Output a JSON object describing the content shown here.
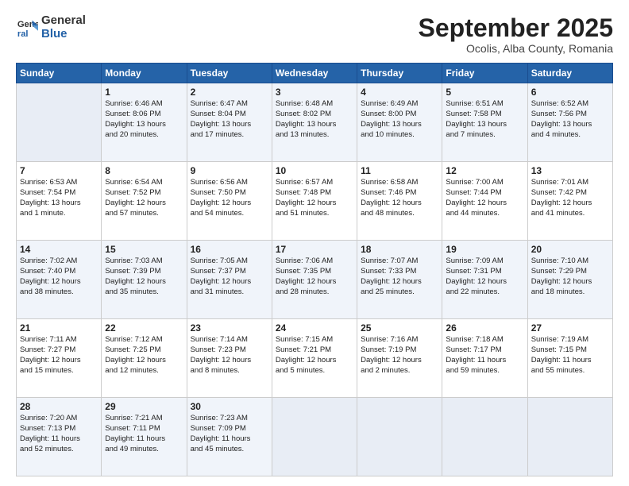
{
  "logo": {
    "line1": "General",
    "line2": "Blue"
  },
  "title": "September 2025",
  "subtitle": "Ocolis, Alba County, Romania",
  "days": [
    "Sunday",
    "Monday",
    "Tuesday",
    "Wednesday",
    "Thursday",
    "Friday",
    "Saturday"
  ],
  "weeks": [
    [
      {
        "num": "",
        "text": ""
      },
      {
        "num": "1",
        "text": "Sunrise: 6:46 AM\nSunset: 8:06 PM\nDaylight: 13 hours\nand 20 minutes."
      },
      {
        "num": "2",
        "text": "Sunrise: 6:47 AM\nSunset: 8:04 PM\nDaylight: 13 hours\nand 17 minutes."
      },
      {
        "num": "3",
        "text": "Sunrise: 6:48 AM\nSunset: 8:02 PM\nDaylight: 13 hours\nand 13 minutes."
      },
      {
        "num": "4",
        "text": "Sunrise: 6:49 AM\nSunset: 8:00 PM\nDaylight: 13 hours\nand 10 minutes."
      },
      {
        "num": "5",
        "text": "Sunrise: 6:51 AM\nSunset: 7:58 PM\nDaylight: 13 hours\nand 7 minutes."
      },
      {
        "num": "6",
        "text": "Sunrise: 6:52 AM\nSunset: 7:56 PM\nDaylight: 13 hours\nand 4 minutes."
      }
    ],
    [
      {
        "num": "7",
        "text": "Sunrise: 6:53 AM\nSunset: 7:54 PM\nDaylight: 13 hours\nand 1 minute."
      },
      {
        "num": "8",
        "text": "Sunrise: 6:54 AM\nSunset: 7:52 PM\nDaylight: 12 hours\nand 57 minutes."
      },
      {
        "num": "9",
        "text": "Sunrise: 6:56 AM\nSunset: 7:50 PM\nDaylight: 12 hours\nand 54 minutes."
      },
      {
        "num": "10",
        "text": "Sunrise: 6:57 AM\nSunset: 7:48 PM\nDaylight: 12 hours\nand 51 minutes."
      },
      {
        "num": "11",
        "text": "Sunrise: 6:58 AM\nSunset: 7:46 PM\nDaylight: 12 hours\nand 48 minutes."
      },
      {
        "num": "12",
        "text": "Sunrise: 7:00 AM\nSunset: 7:44 PM\nDaylight: 12 hours\nand 44 minutes."
      },
      {
        "num": "13",
        "text": "Sunrise: 7:01 AM\nSunset: 7:42 PM\nDaylight: 12 hours\nand 41 minutes."
      }
    ],
    [
      {
        "num": "14",
        "text": "Sunrise: 7:02 AM\nSunset: 7:40 PM\nDaylight: 12 hours\nand 38 minutes."
      },
      {
        "num": "15",
        "text": "Sunrise: 7:03 AM\nSunset: 7:39 PM\nDaylight: 12 hours\nand 35 minutes."
      },
      {
        "num": "16",
        "text": "Sunrise: 7:05 AM\nSunset: 7:37 PM\nDaylight: 12 hours\nand 31 minutes."
      },
      {
        "num": "17",
        "text": "Sunrise: 7:06 AM\nSunset: 7:35 PM\nDaylight: 12 hours\nand 28 minutes."
      },
      {
        "num": "18",
        "text": "Sunrise: 7:07 AM\nSunset: 7:33 PM\nDaylight: 12 hours\nand 25 minutes."
      },
      {
        "num": "19",
        "text": "Sunrise: 7:09 AM\nSunset: 7:31 PM\nDaylight: 12 hours\nand 22 minutes."
      },
      {
        "num": "20",
        "text": "Sunrise: 7:10 AM\nSunset: 7:29 PM\nDaylight: 12 hours\nand 18 minutes."
      }
    ],
    [
      {
        "num": "21",
        "text": "Sunrise: 7:11 AM\nSunset: 7:27 PM\nDaylight: 12 hours\nand 15 minutes."
      },
      {
        "num": "22",
        "text": "Sunrise: 7:12 AM\nSunset: 7:25 PM\nDaylight: 12 hours\nand 12 minutes."
      },
      {
        "num": "23",
        "text": "Sunrise: 7:14 AM\nSunset: 7:23 PM\nDaylight: 12 hours\nand 8 minutes."
      },
      {
        "num": "24",
        "text": "Sunrise: 7:15 AM\nSunset: 7:21 PM\nDaylight: 12 hours\nand 5 minutes."
      },
      {
        "num": "25",
        "text": "Sunrise: 7:16 AM\nSunset: 7:19 PM\nDaylight: 12 hours\nand 2 minutes."
      },
      {
        "num": "26",
        "text": "Sunrise: 7:18 AM\nSunset: 7:17 PM\nDaylight: 11 hours\nand 59 minutes."
      },
      {
        "num": "27",
        "text": "Sunrise: 7:19 AM\nSunset: 7:15 PM\nDaylight: 11 hours\nand 55 minutes."
      }
    ],
    [
      {
        "num": "28",
        "text": "Sunrise: 7:20 AM\nSunset: 7:13 PM\nDaylight: 11 hours\nand 52 minutes."
      },
      {
        "num": "29",
        "text": "Sunrise: 7:21 AM\nSunset: 7:11 PM\nDaylight: 11 hours\nand 49 minutes."
      },
      {
        "num": "30",
        "text": "Sunrise: 7:23 AM\nSunset: 7:09 PM\nDaylight: 11 hours\nand 45 minutes."
      },
      {
        "num": "",
        "text": ""
      },
      {
        "num": "",
        "text": ""
      },
      {
        "num": "",
        "text": ""
      },
      {
        "num": "",
        "text": ""
      }
    ]
  ]
}
